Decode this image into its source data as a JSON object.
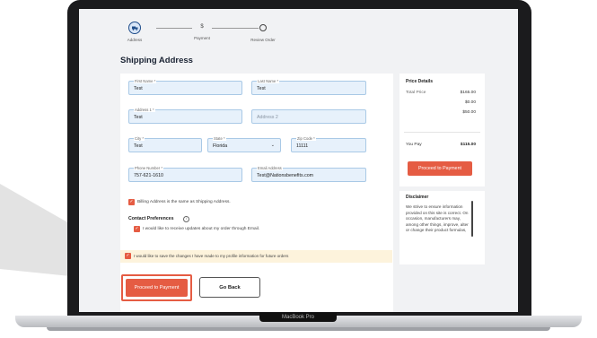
{
  "stepper": {
    "steps": [
      {
        "label": "Address",
        "icon": "truck-icon"
      },
      {
        "label": "Payment",
        "icon": "dollar-icon",
        "glyph": "$"
      },
      {
        "label": "Review Order",
        "icon": "circle-icon"
      }
    ]
  },
  "page_title": "Shipping Address",
  "fields": {
    "first_name": {
      "label": "First Name *",
      "value": "Test"
    },
    "last_name": {
      "label": "Last Name *",
      "value": "Test"
    },
    "address1": {
      "label": "Address 1 *",
      "value": "Test"
    },
    "address2": {
      "placeholder": "Address 2"
    },
    "city": {
      "label": "City *",
      "value": "Test"
    },
    "state": {
      "label": "State *",
      "value": "Florida"
    },
    "zip": {
      "label": "Zip Code *",
      "value": "11111"
    },
    "phone": {
      "label": "Phone Number *",
      "value": "757-621-1610"
    },
    "email": {
      "label": "Email Address",
      "value": "Test@Nationsbenefits.com"
    }
  },
  "billing_same_label": "Billing Address is the same as Shipping Address.",
  "contact_pref": {
    "header": "Contact Preferences",
    "email_opt_label": "I would like to receive updates about my order through Email."
  },
  "save_profile_label": "I would like to save the changes I have made to my profile information for future orders",
  "buttons": {
    "proceed": "Proceed to Payment",
    "go_back": "Go Back"
  },
  "price_details": {
    "title": "Price Details",
    "total_label": "Total Price",
    "amounts": [
      "$165.00",
      "$0.00",
      "$50.00"
    ],
    "you_pay_label": "You Pay",
    "you_pay_value": "$115.00",
    "proceed_button": "Proceed to Payment"
  },
  "disclaimer": {
    "title": "Disclaimer",
    "text": "We strive to ensure information provided on this site is correct. On occasion, manufacturers may, among other things, improve, alter or change their product formulas,"
  },
  "device_label": "MacBook Pro",
  "colors": {
    "accent": "#e55c43",
    "field_bg": "#e7f1fb",
    "highlight": "#fdf3dc",
    "step_active": "#1f4d8a"
  }
}
